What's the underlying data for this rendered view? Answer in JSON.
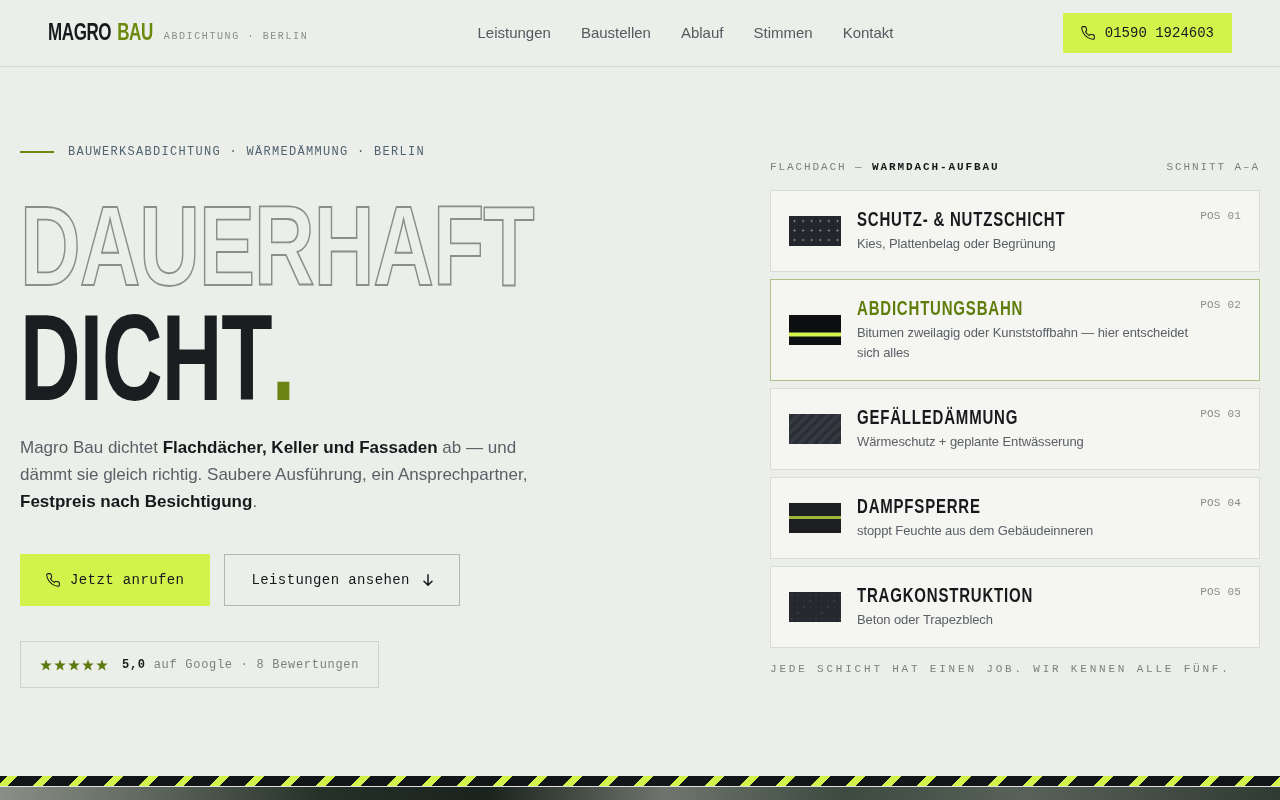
{
  "header": {
    "logo": {
      "name": "MAGRO",
      "accent": "BAU"
    },
    "tagline": "ABDICHTUNG · BERLIN",
    "nav": [
      "Leistungen",
      "Baustellen",
      "Ablauf",
      "Stimmen",
      "Kontakt"
    ],
    "phone": "01590 1924603"
  },
  "hero": {
    "eyebrow": "BAUWERKSABDICHTUNG · WÄRMEDÄMMUNG · BERLIN",
    "headline": {
      "outline": "DAUERHAFT",
      "solid": "DICHT",
      "accent": "."
    },
    "intro": "Magro Bau dichtet **Flachdächer, Keller und Fassaden** ab — und dämmt sie gleich richtig. Saubere Ausführung, ein Ansprechpartner, **Festpreis nach Besichtigung**.",
    "buttons": [
      {
        "kind": "call",
        "label": "Jetzt anrufen"
      },
      {
        "kind": "scroll",
        "label": "Leistungen ansehen"
      }
    ],
    "rating": {
      "stars": 5,
      "score": "5,0",
      "detail": "auf Google · 8 Bewertungen"
    }
  },
  "layer_stack": {
    "title": "FLACHDACH — **WARMDACH-AUFBAU**",
    "label": "SCHNITT A–A",
    "layers": [
      {
        "kind": "gravel",
        "title": "SCHUTZ- & NUTZSCHICHT",
        "description": "Kies, Plattenbelag oder Begrünung",
        "position": "POS 01",
        "selected": false
      },
      {
        "kind": "membrane",
        "title": "ABDICHTUNGSBAHN",
        "description": "Bitumen zweilagig oder Kunststoffbahn — hier entscheidet sich alles",
        "position": "POS 02",
        "selected": true
      },
      {
        "kind": "insulation",
        "title": "GEFÄLLEDÄMMUNG",
        "description": "Wärmeschutz + geplante Entwässerung",
        "position": "POS 03",
        "selected": false
      },
      {
        "kind": "vapor",
        "title": "DAMPFSPERRE",
        "description": "stoppt Feuchte aus dem Gebäudeinneren",
        "position": "POS 04",
        "selected": false
      },
      {
        "kind": "concrete",
        "title": "TRAGKONSTRUKTION",
        "description": "Beton oder Trapezblech",
        "position": "POS 05",
        "selected": false
      }
    ],
    "note": "JEDE SCHICHT HAT EINEN JOB. WIR KENNEN ALLE FÜNF."
  }
}
